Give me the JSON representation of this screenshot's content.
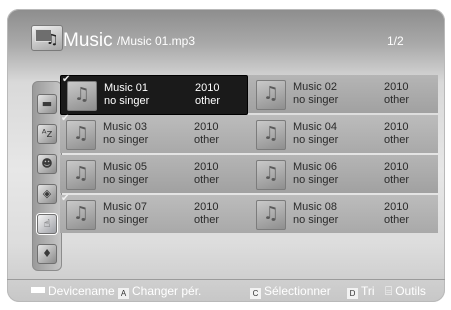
{
  "header": {
    "title": "Music",
    "path": "/Music 01.mp3",
    "page": "1/2",
    "icon": "music-folder-icon"
  },
  "sidebar": {
    "items": [
      {
        "icon": "folder-icon",
        "glyph": "▬",
        "active": false
      },
      {
        "icon": "sort-az-icon",
        "glyph": "ᴬz",
        "active": false
      },
      {
        "icon": "artist-icon",
        "glyph": "☻",
        "active": false
      },
      {
        "icon": "album-icon",
        "glyph": "◈",
        "active": false
      },
      {
        "icon": "genre-icon",
        "glyph": "☝",
        "active": true
      },
      {
        "icon": "mood-icon",
        "glyph": "♦",
        "active": false
      }
    ]
  },
  "items": [
    {
      "title": "Music 01",
      "singer": "no singer",
      "year": "2010",
      "genre": "other",
      "checked": true,
      "selected": true
    },
    {
      "title": "Music 02",
      "singer": "no singer",
      "year": "2010",
      "genre": "other",
      "checked": false,
      "selected": false
    },
    {
      "title": "Music 03",
      "singer": "no singer",
      "year": "2010",
      "genre": "other",
      "checked": true,
      "selected": false
    },
    {
      "title": "Music 04",
      "singer": "no singer",
      "year": "2010",
      "genre": "other",
      "checked": false,
      "selected": false
    },
    {
      "title": "Music 05",
      "singer": "no singer",
      "year": "2010",
      "genre": "other",
      "checked": false,
      "selected": false
    },
    {
      "title": "Music 06",
      "singer": "no singer",
      "year": "2010",
      "genre": "other",
      "checked": false,
      "selected": false
    },
    {
      "title": "Music 07",
      "singer": "no singer",
      "year": "2010",
      "genre": "other",
      "checked": true,
      "selected": false
    },
    {
      "title": "Music 08",
      "singer": "no singer",
      "year": "2010",
      "genre": "other",
      "checked": false,
      "selected": false
    }
  ],
  "thumb_glyph": "♫",
  "check_glyph": "✔",
  "footer": {
    "device": {
      "label": "Devicename",
      "icon": "device-key-icon"
    },
    "change": {
      "key": "A",
      "label": "Changer pér."
    },
    "select": {
      "key": "C",
      "label": "Sélectionner"
    },
    "sort": {
      "key": "D",
      "label": "Tri"
    },
    "tools": {
      "label": "Outils",
      "icon": "tools-icon",
      "glyph": "⌸"
    }
  },
  "colors": {
    "selected_bg": "#1a1a1a",
    "text_dark": "#2a2a2a",
    "text_light": "#ffffff"
  }
}
